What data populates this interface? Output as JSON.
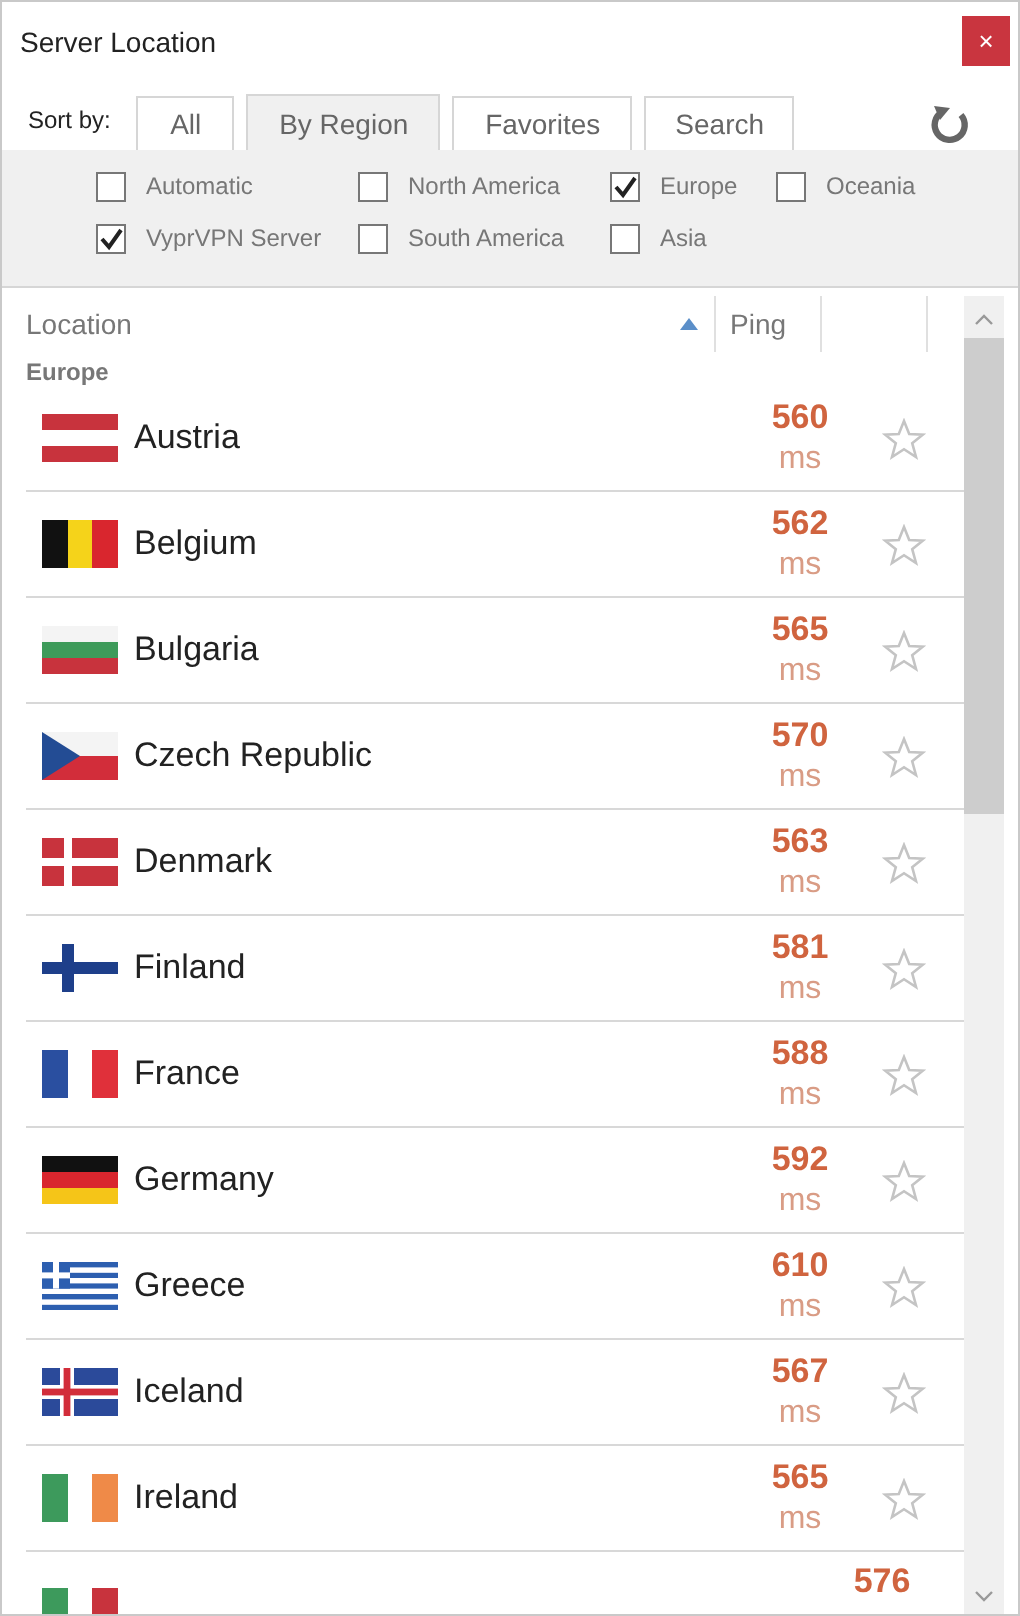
{
  "window": {
    "title": "Server Location",
    "close": "×"
  },
  "sort_label": "Sort by:",
  "tabs": [
    {
      "label": "All",
      "selected": false
    },
    {
      "label": "By Region",
      "selected": true
    },
    {
      "label": "Favorites",
      "selected": false
    },
    {
      "label": "Search",
      "selected": false
    }
  ],
  "filters": [
    [
      {
        "label": "Automatic",
        "checked": false
      },
      {
        "label": "North America",
        "checked": false
      },
      {
        "label": "Europe",
        "checked": true
      },
      {
        "label": "Oceania",
        "checked": false
      }
    ],
    [
      {
        "label": "VyprVPN Server",
        "checked": true
      },
      {
        "label": "South America",
        "checked": false
      },
      {
        "label": "Asia",
        "checked": false
      }
    ]
  ],
  "table": {
    "columns": [
      "Location",
      "Ping"
    ],
    "group": "Europe",
    "rows": [
      {
        "kind": "at",
        "name": "Austria",
        "ping": "560",
        "unit": "ms",
        "favorite": false
      },
      {
        "kind": "be",
        "name": "Belgium",
        "ping": "562",
        "unit": "ms",
        "favorite": false
      },
      {
        "kind": "bg",
        "name": "Bulgaria",
        "ping": "565",
        "unit": "ms",
        "favorite": false
      },
      {
        "kind": "cz",
        "name": "Czech Republic",
        "ping": "570",
        "unit": "ms",
        "favorite": false
      },
      {
        "kind": "dk",
        "name": "Denmark",
        "ping": "563",
        "unit": "ms",
        "favorite": false
      },
      {
        "kind": "fi",
        "name": "Finland",
        "ping": "581",
        "unit": "ms",
        "favorite": false
      },
      {
        "kind": "fr",
        "name": "France",
        "ping": "588",
        "unit": "ms",
        "favorite": false
      },
      {
        "kind": "de",
        "name": "Germany",
        "ping": "592",
        "unit": "ms",
        "favorite": false
      },
      {
        "kind": "gr",
        "name": "Greece",
        "ping": "610",
        "unit": "ms",
        "favorite": false
      },
      {
        "kind": "is",
        "name": "Iceland",
        "ping": "567",
        "unit": "ms",
        "favorite": false
      },
      {
        "kind": "ie",
        "name": "Ireland",
        "ping": "565",
        "unit": "ms",
        "favorite": false
      },
      {
        "kind": "it",
        "ping": "576"
      }
    ]
  }
}
